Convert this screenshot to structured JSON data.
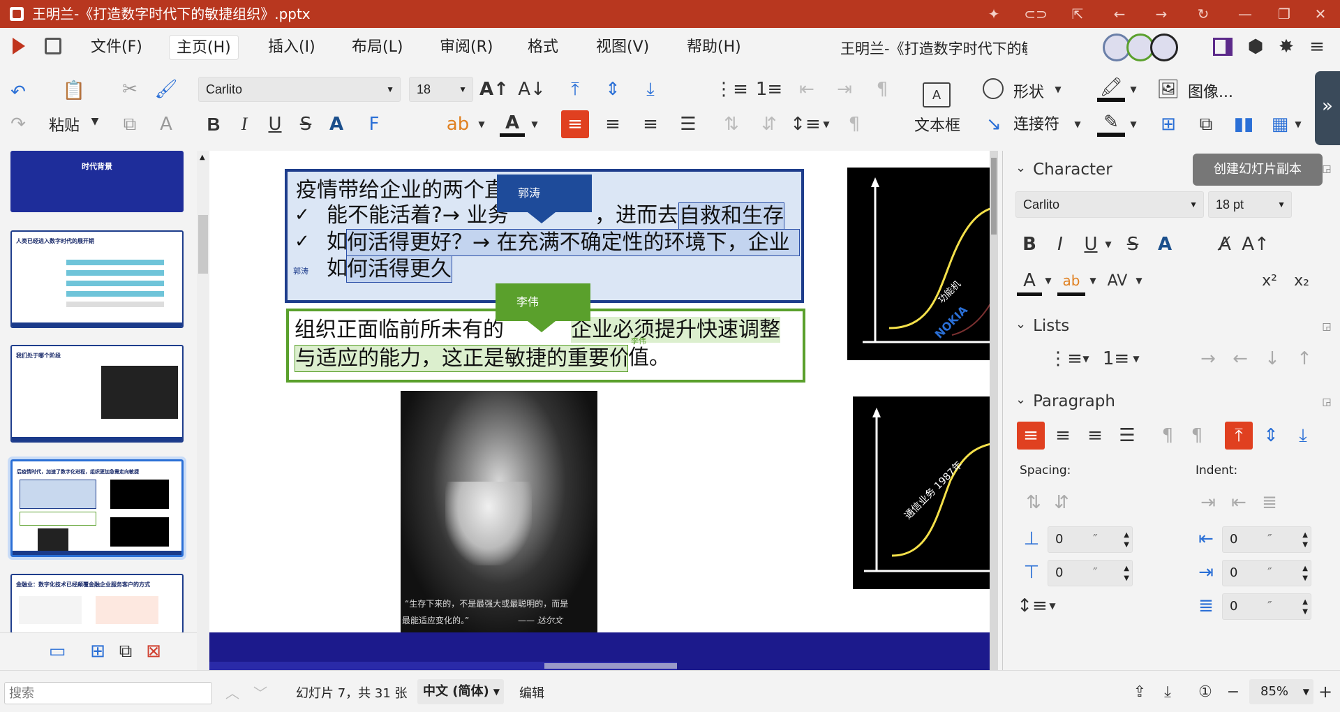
{
  "window": {
    "title": "王明兰-《打造数字时代下的敏捷组织》.pptx"
  },
  "menu": {
    "items": [
      "文件(F)",
      "主页(H)",
      "插入(I)",
      "布局(L)",
      "审阅(R)",
      "格式",
      "视图(V)",
      "帮助(H)"
    ],
    "doc_title": "王明兰-《打造数字时代下的敏"
  },
  "ribbon": {
    "paste": "粘贴",
    "font": "Carlito",
    "size": "18",
    "textbox": "文本框",
    "shape": "形状",
    "connector": "连接符",
    "image": "图像..."
  },
  "thumbs": {
    "t1": "时代背景",
    "t2": "人类已经进入数字时代的展开期",
    "t3": "我们处于哪个阶段",
    "t4": "后疫情时代，加速了数字化进程，组织更加急需走向敏捷",
    "t5": "金融业：数字化技术已经颠覆金融企业服务客户的方式"
  },
  "slide": {
    "box1": {
      "line1": "疫情带给企业的两个直",
      "line2": "能不能活着?→ 业务",
      "line2b": "，进而去",
      "line2c": "自救和生存",
      "line3": "何活得更好？→  在充满不确定性的环境下，企业",
      "line4": "何活得更久"
    },
    "box2": {
      "line1a": "组织正面临前所未有的",
      "line1b": "企业必须提升快速调整",
      "line2a": "与适应的能力，这正是敏捷的重要价",
      "line2b": "值。"
    },
    "comment1": "郭涛",
    "comment2": "李伟",
    "marker1": "郭涛",
    "marker2": "李伟",
    "quote1": "“生存下来的，不是最强大或最聪明的，而是",
    "quote2": "最能适应变化的。”",
    "quote3": "—— 达尔文",
    "chart1_label": "功能机",
    "chart1_brand": "NOKIA",
    "chart2_label": "通信业务 1987年"
  },
  "panel": {
    "tooltip": "创建幻灯片副本",
    "character": "Character",
    "font": "Carlito",
    "size": "18 pt",
    "lists": "Lists",
    "paragraph": "Paragraph",
    "spacing": "Spacing:",
    "indent": "Indent:",
    "v1": "0",
    "v2": "0",
    "v3": "0",
    "v4": "0",
    "v5": "0",
    "unit": "″"
  },
  "status": {
    "search_placeholder": "搜索",
    "slide_info": "幻灯片 7，共 31 张",
    "language": "中文 (简体)",
    "mode": "编辑",
    "zoom": "85%"
  },
  "colors": {
    "titlebar": "#b8371f",
    "accent_blue": "#1e3d8c",
    "accent_green": "#5aa02c",
    "selection": "#e04020"
  }
}
